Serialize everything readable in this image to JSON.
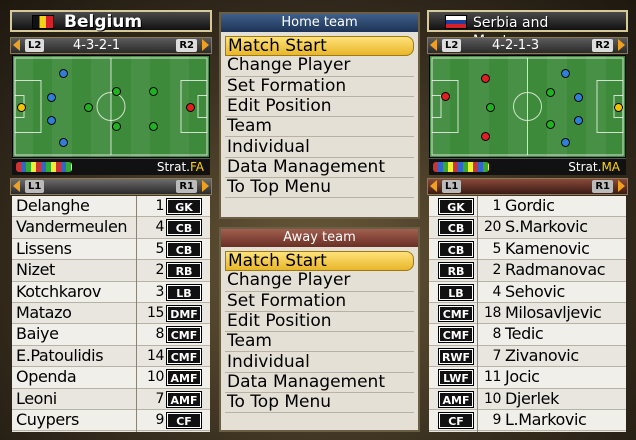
{
  "home": {
    "team_name": "Belgium",
    "flag_colors": [
      "#111111",
      "#f3d219",
      "#d8202a"
    ],
    "left_tag": "L2",
    "right_tag": "R2",
    "formation": "4-3-2-1",
    "strategy_label": "Strat.",
    "strategy_value": "FA",
    "roster_left_tag": "L1",
    "roster_right_tag": "R1",
    "players": [
      {
        "name": "Delanghe",
        "num": "1",
        "pos": "GK"
      },
      {
        "name": "Vandermeulen",
        "num": "4",
        "pos": "CB"
      },
      {
        "name": "Lissens",
        "num": "5",
        "pos": "CB"
      },
      {
        "name": "Nizet",
        "num": "2",
        "pos": "RB"
      },
      {
        "name": "Kotchkarov",
        "num": "3",
        "pos": "LB"
      },
      {
        "name": "Matazo",
        "num": "15",
        "pos": "DMF"
      },
      {
        "name": "Baiye",
        "num": "8",
        "pos": "CMF"
      },
      {
        "name": "E.Patoulidis",
        "num": "14",
        "pos": "CMF"
      },
      {
        "name": "Openda",
        "num": "10",
        "pos": "AMF"
      },
      {
        "name": "Leoni",
        "num": "7",
        "pos": "AMF"
      },
      {
        "name": "Cuypers",
        "num": "9",
        "pos": "CF"
      }
    ]
  },
  "away": {
    "team_name": "Serbia and Montenegro",
    "flag_colors": [
      "#d8202a",
      "#1f3f9a",
      "#ffffff"
    ],
    "left_tag": "L2",
    "right_tag": "R2",
    "formation": "4-2-1-3",
    "strategy_label": "Strat.",
    "strategy_value": "MA",
    "roster_left_tag": "L1",
    "roster_right_tag": "R1",
    "players": [
      {
        "name": "Gordic",
        "num": "1",
        "pos": "GK"
      },
      {
        "name": "S.Markovic",
        "num": "20",
        "pos": "CB"
      },
      {
        "name": "Kamenovic",
        "num": "5",
        "pos": "CB"
      },
      {
        "name": "Radmanovac",
        "num": "2",
        "pos": "RB"
      },
      {
        "name": "Sehovic",
        "num": "4",
        "pos": "LB"
      },
      {
        "name": "Milosavljevic",
        "num": "18",
        "pos": "CMF"
      },
      {
        "name": "Tedic",
        "num": "8",
        "pos": "CMF"
      },
      {
        "name": "Zivanovic",
        "num": "7",
        "pos": "RWF"
      },
      {
        "name": "Jocic",
        "num": "11",
        "pos": "LWF"
      },
      {
        "name": "Djerlek",
        "num": "10",
        "pos": "AMF"
      },
      {
        "name": "L.Markovic",
        "num": "9",
        "pos": "CF"
      }
    ]
  },
  "home_menu": {
    "title": "Home team",
    "items": [
      "Match Start",
      "Change Player",
      "Set Formation",
      "Edit Position",
      "Team",
      "Individual",
      "Data Management",
      "To Top Menu"
    ],
    "selected": 0
  },
  "away_menu": {
    "title": "Away team",
    "items": [
      "Match Start",
      "Change Player",
      "Set Formation",
      "Edit Position",
      "Team",
      "Individual",
      "Data Management",
      "To Top Menu"
    ],
    "selected": 0
  },
  "colors": {
    "gk_dot": "#f2c400",
    "def_dot": "#2f7fd8",
    "mid_dot": "#20b020",
    "att_dot": "#e02020"
  }
}
